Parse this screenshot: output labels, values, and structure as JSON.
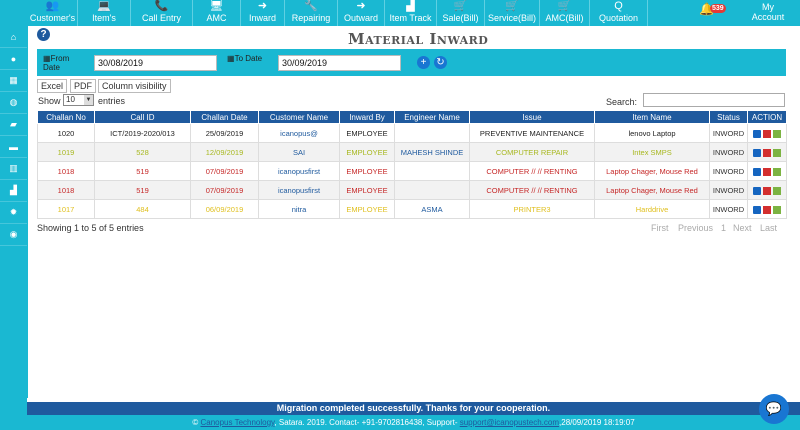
{
  "nav": [
    {
      "label": "Customer's",
      "icon": "users-icon",
      "glyph": "👥"
    },
    {
      "label": "Item's",
      "icon": "laptop-icon",
      "glyph": "💻"
    },
    {
      "label": "Call Entry",
      "icon": "phone-icon",
      "glyph": "📞"
    },
    {
      "label": "AMC",
      "icon": "monitor-icon",
      "glyph": "🖥"
    },
    {
      "label": "Inward",
      "icon": "sign-in-icon",
      "glyph": "➜"
    },
    {
      "label": "Repairing",
      "icon": "wrench-icon",
      "glyph": "🔧"
    },
    {
      "label": "Outward",
      "icon": "sign-out-icon",
      "glyph": "➜"
    },
    {
      "label": "Item Track",
      "icon": "area-chart-icon",
      "glyph": "▟"
    },
    {
      "label": "Sale(Bill)",
      "icon": "cart-icon",
      "glyph": "🛒"
    },
    {
      "label": "Service(Bill)",
      "icon": "service-cart-icon",
      "glyph": "🛒"
    },
    {
      "label": "AMC(Bill)",
      "icon": "amc-cart-icon",
      "glyph": "🛒"
    },
    {
      "label": "Quotation",
      "icon": "quotation-icon",
      "glyph": "Q"
    }
  ],
  "notifications": {
    "count": "539"
  },
  "account": {
    "line1": "My",
    "line2": "Account"
  },
  "page": {
    "title": "Material Inward"
  },
  "filter": {
    "from_label": "From Date",
    "from_value": "30/08/2019",
    "to_label": "To Date",
    "to_value": "30/09/2019"
  },
  "export": {
    "excel": "Excel",
    "pdf": "PDF",
    "colvis": "Column visibility"
  },
  "length": {
    "show": "Show",
    "value": "10",
    "entries": "entries"
  },
  "search": {
    "label": "Search:"
  },
  "table": {
    "headers": [
      "Challan No",
      "Call ID",
      "Challan Date",
      "Customer Name",
      "Inward By",
      "Engineer Name",
      "Issue",
      "Item Name",
      "Status",
      "ACTION"
    ],
    "rows": [
      {
        "color": "#222222",
        "cells": [
          "1020",
          "ICT/2019-2020/013",
          "25/09/2019",
          "icanopus@",
          "EMPLOYEE",
          "",
          "PREVENTIVE MAINTENANCE",
          "lenovo Laptop",
          "INWORD"
        ],
        "customer_color": "#1f5a9e"
      },
      {
        "color": "#a8b820",
        "cells": [
          "1019",
          "528",
          "12/09/2019",
          "SAI",
          "EMPLOYEE",
          "MAHESH SHINDE",
          "COMPUTER REPAIR",
          "Intex SMPS",
          "INWORD"
        ],
        "customer_color": "#1f5a9e"
      },
      {
        "color": "#c62828",
        "cells": [
          "1018",
          "519",
          "07/09/2019",
          "icanopusfirst",
          "EMPLOYEE",
          "",
          "COMPUTER // // RENTING",
          "Laptop Chager, Mouse Red",
          "INWORD"
        ],
        "customer_color": "#1f5a9e"
      },
      {
        "color": "#c62828",
        "cells": [
          "1018",
          "519",
          "07/09/2019",
          "icanopusfirst",
          "EMPLOYEE",
          "",
          "COMPUTER // // RENTING",
          "Laptop Chager, Mouse Red",
          "INWORD"
        ],
        "customer_color": "#1f5a9e"
      },
      {
        "color": "#e0c020",
        "cells": [
          "1017",
          "484",
          "06/09/2019",
          "nitra",
          "EMPLOYEE",
          "ASMA",
          "PRINTER3",
          "Harddrive",
          "INWORD"
        ],
        "customer_color": "#1f5a9e"
      }
    ]
  },
  "info": "Showing 1 to 5 of 5 entries",
  "pager": {
    "first": "First",
    "previous": "Previous",
    "page": "1",
    "next": "Next",
    "last": "Last"
  },
  "footer": {
    "message": "Migration completed successfully. Thanks for your cooperation.",
    "copy": "©",
    "company": "Canopus Technology",
    "contact": ", Satara. 2019. Contact- +91-9702816438, Support-",
    "email": "support@icanopustech.com",
    "datetime": ",28/09/2019 18:19:07"
  },
  "colors": {
    "primary": "#1ab8d2",
    "header": "#1f5a9e"
  }
}
